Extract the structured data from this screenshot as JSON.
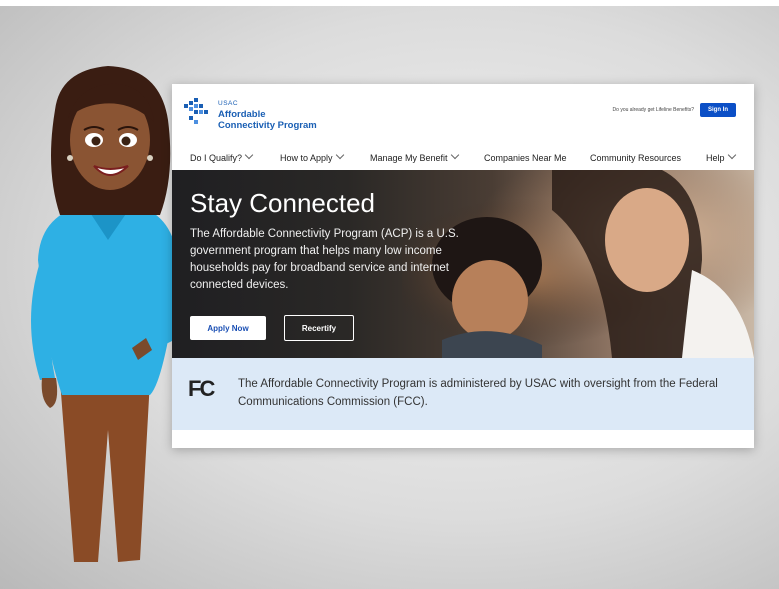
{
  "header": {
    "brand_small": "USAC",
    "brand_line1": "Affordable",
    "brand_line2": "Connectivity Program",
    "signin_question": "Do you already get Lifeline Benefits?",
    "signin_label": "Sign In"
  },
  "nav": {
    "items": [
      {
        "label": "Do I Qualify?",
        "has_menu": true
      },
      {
        "label": "How to Apply",
        "has_menu": true
      },
      {
        "label": "Manage My Benefit",
        "has_menu": true
      },
      {
        "label": "Companies Near Me",
        "has_menu": false
      },
      {
        "label": "Community Resources",
        "has_menu": false
      },
      {
        "label": "Help",
        "has_menu": true
      }
    ]
  },
  "hero": {
    "title": "Stay Connected",
    "text": "The Affordable Connectivity Program (ACP) is a U.S. government program that helps many low income households pay for broadband service and internet connected devices.",
    "apply_label": "Apply Now",
    "recertify_label": "Recertify"
  },
  "fcc": {
    "logo_text": "FC",
    "text": "The Affordable Connectivity Program is administered by USAC with oversight from the Federal Communications Commission (FCC)."
  },
  "colors": {
    "brand_blue": "#1a5fb4",
    "signin_blue": "#0b4fc6",
    "band_blue": "#dce9f7"
  }
}
